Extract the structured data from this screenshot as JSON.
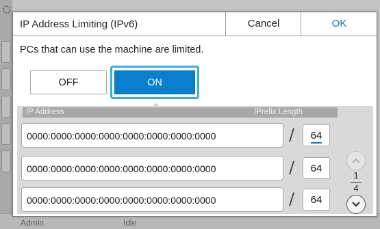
{
  "dialog": {
    "title": "IP Address Limiting (IPv6)",
    "cancel_label": "Cancel",
    "ok_label": "OK",
    "description": "PCs that can use the machine are limited."
  },
  "toggle": {
    "off_label": "OFF",
    "on_label": "ON",
    "selected": "ON"
  },
  "table": {
    "col_ip": "IP Address",
    "col_prefix": "/Prefix Length",
    "separator": "/",
    "rows": [
      {
        "address": "0000:0000:0000:0000:0000:0000:0000:0000",
        "prefix": "64"
      },
      {
        "address": "0000:0000:0000:0000:0000:0000:0000:0000",
        "prefix": "64"
      },
      {
        "address": "0000:0000:0000:0000:0000:0000:0000:0000",
        "prefix": "64"
      }
    ]
  },
  "pager": {
    "current": "1",
    "total": "4"
  },
  "background": {
    "status_left": "Admin",
    "status_mid": "Idle"
  },
  "colors": {
    "accent": "#0a7fcd",
    "highlight_border": "#33aee0",
    "ok_text": "#0078c8"
  }
}
